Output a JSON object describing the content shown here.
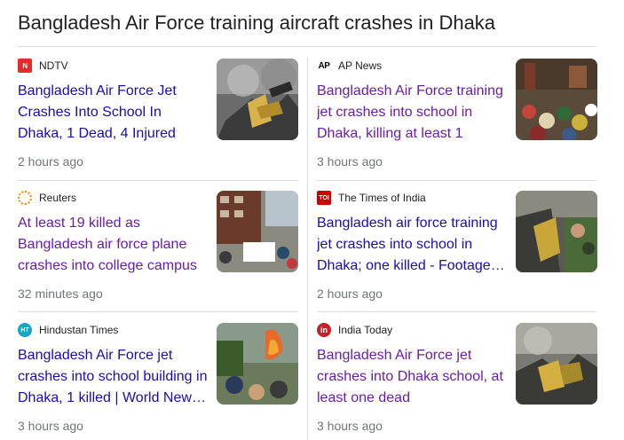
{
  "heading": "Bangladesh Air Force training aircraft crashes in Dhaka",
  "articles": [
    {
      "source": "NDTV",
      "logo": "N",
      "title": "Bangladesh Air Force Jet Crashes Into School In Dhaka, 1 Dead, 4 Injured",
      "time": "2 hours ago"
    },
    {
      "source": "AP News",
      "logo": "AP",
      "title": "Bangladesh Air Force training jet crashes into school in Dhaka, killing at least 1",
      "time": "3 hours ago"
    },
    {
      "source": "Reuters",
      "logo": "",
      "title": "At least 19 killed as Bangladesh air force plane crashes into college campus",
      "time": "32 minutes ago"
    },
    {
      "source": "The Times of India",
      "logo": "TOI",
      "title": "Bangladesh air force training jet crashes into school in Dhaka; one killed - Footage…",
      "time": "2 hours ago"
    },
    {
      "source": "Hindustan Times",
      "logo": "HT",
      "title": "Bangladesh Air Force jet crashes into school building in Dhaka, 1 killed | World New…",
      "time": "3 hours ago"
    },
    {
      "source": "India Today",
      "logo": "in",
      "title": "Bangladesh Air Force jet crashes into Dhaka school, at least one dead",
      "time": "3 hours ago"
    }
  ],
  "colors": {
    "link_unvisited": "#1a0dab",
    "link_visited": "#681da8",
    "meta_text": "#70757a",
    "divider": "#dadce0"
  }
}
